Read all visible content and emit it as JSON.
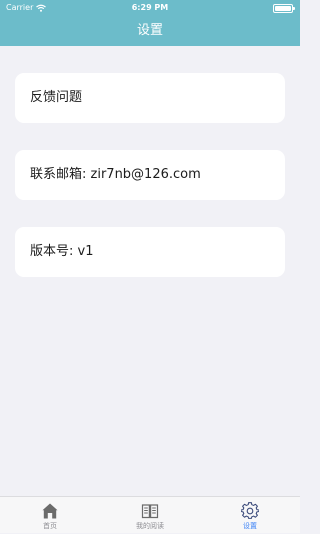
{
  "status_bar": {
    "carrier": "Carrier",
    "time": "6:29 PM"
  },
  "nav": {
    "title": "设置"
  },
  "settings": {
    "items": [
      {
        "label": "反馈问题"
      },
      {
        "label": "联系邮箱: zir7nb@126.com"
      },
      {
        "label": "版本号: v1"
      }
    ]
  },
  "tabbar": {
    "active_index": 2,
    "tabs": [
      {
        "label": "首页",
        "icon": "home-icon"
      },
      {
        "label": "我的阅读",
        "icon": "book-icon"
      },
      {
        "label": "设置",
        "icon": "gear-icon"
      }
    ]
  },
  "colors": {
    "header": "#6cbcca",
    "background": "#f1f1f6",
    "tab_active": "#3b82f6",
    "tab_inactive": "#8e8e93"
  }
}
